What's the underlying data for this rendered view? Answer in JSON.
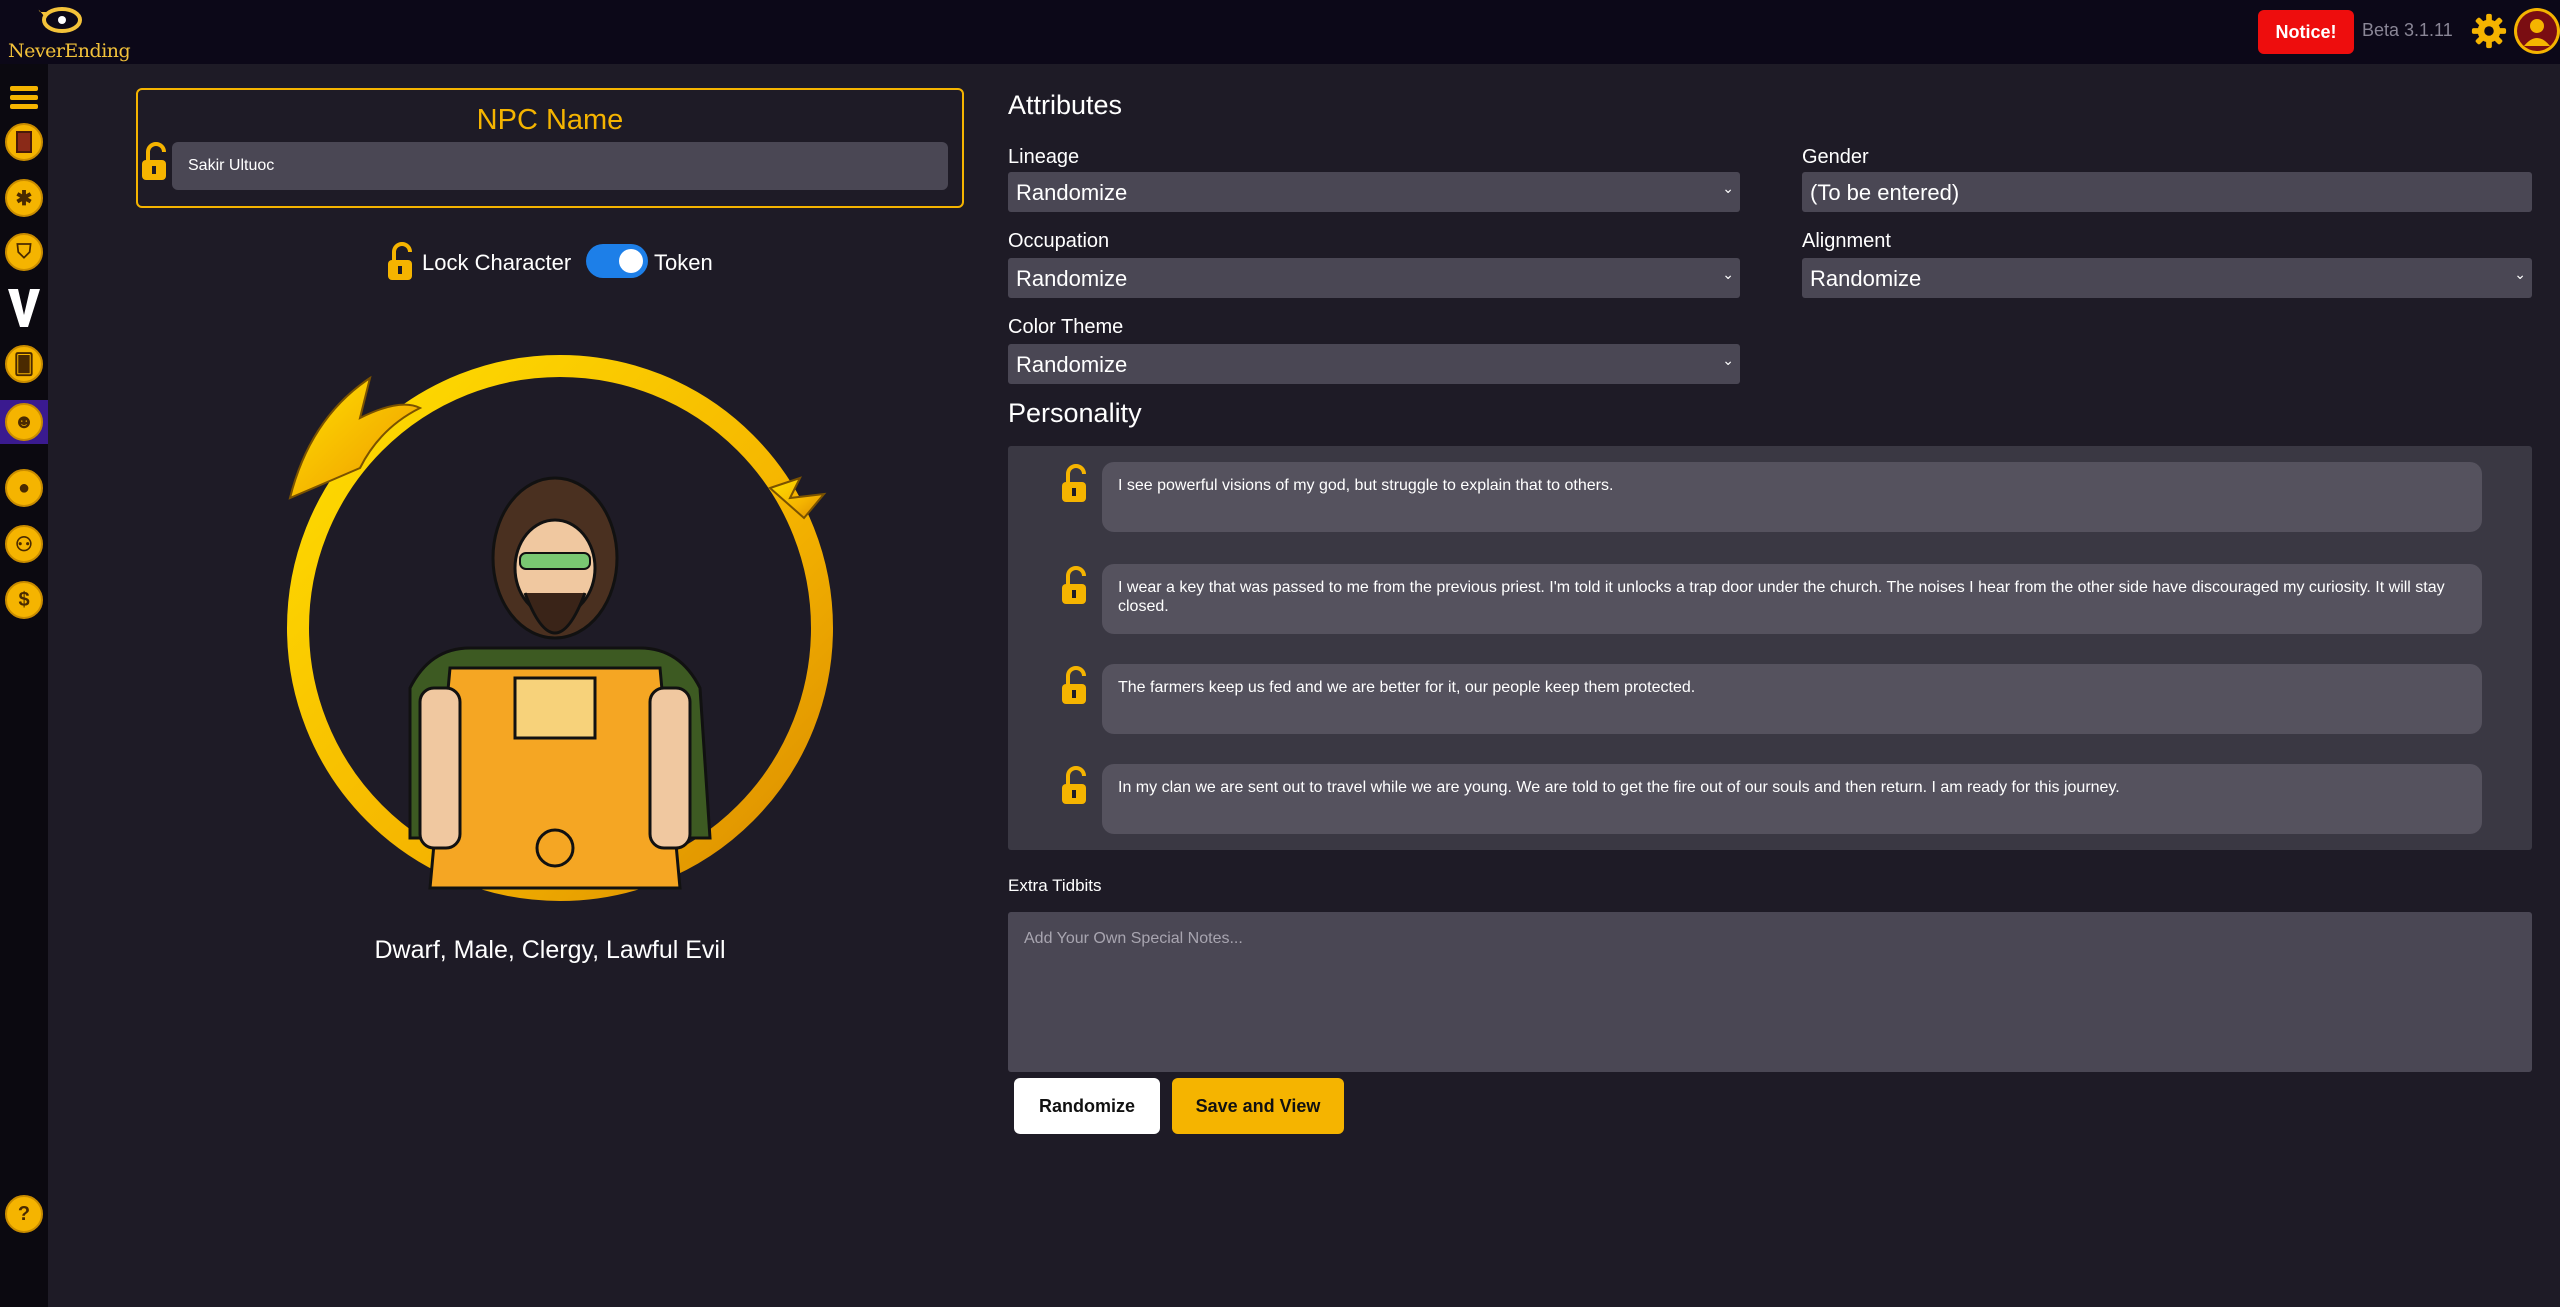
{
  "brand": {
    "logo_text": "NeverEnding"
  },
  "header": {
    "notice_label": "Notice!",
    "version": "Beta 3.1.11"
  },
  "sidebar": {
    "items": [
      {
        "name": "menu"
      },
      {
        "name": "book"
      },
      {
        "name": "body"
      },
      {
        "name": "shield"
      },
      {
        "name": "versus"
      },
      {
        "name": "cards"
      },
      {
        "name": "npc"
      },
      {
        "name": "character"
      },
      {
        "name": "party"
      },
      {
        "name": "coin"
      },
      {
        "name": "help"
      }
    ]
  },
  "npc": {
    "title": "NPC Name",
    "name_value": "Sakir Ultuoc",
    "lock_label": "Lock Character",
    "token_label": "Token",
    "token_on": true,
    "summary": "Dwarf, Male, Clergy, Lawful Evil"
  },
  "attributes": {
    "title": "Attributes",
    "lineage": {
      "label": "Lineage",
      "value": "Randomize"
    },
    "gender": {
      "label": "Gender",
      "value": "(To be entered)"
    },
    "occupation": {
      "label": "Occupation",
      "value": "Randomize"
    },
    "alignment": {
      "label": "Alignment",
      "value": "Randomize"
    },
    "color_theme": {
      "label": "Color Theme",
      "value": "Randomize"
    }
  },
  "personality": {
    "title": "Personality",
    "traits": [
      "I see powerful visions of my god, but struggle to explain that to others.",
      "I wear a key that was passed to me from the previous priest. I'm told it unlocks a trap door under the church. The noises I hear from the other side have discouraged my curiosity. It will stay closed.",
      "The farmers keep us fed and we are better for it, our people keep them protected.",
      "In my clan we are sent out to travel while we are young. We are told to get the fire out of our souls and then return.  I am ready for this journey."
    ]
  },
  "extra": {
    "label": "Extra Tidbits",
    "placeholder": "Add Your Own Special Notes..."
  },
  "actions": {
    "randomize_label": "Randomize",
    "save_label": "Save and View"
  },
  "colors": {
    "accent": "#f5b400",
    "background": "#1e1b26",
    "notice": "#ee0d0d",
    "toggle": "#1d7fe8"
  }
}
